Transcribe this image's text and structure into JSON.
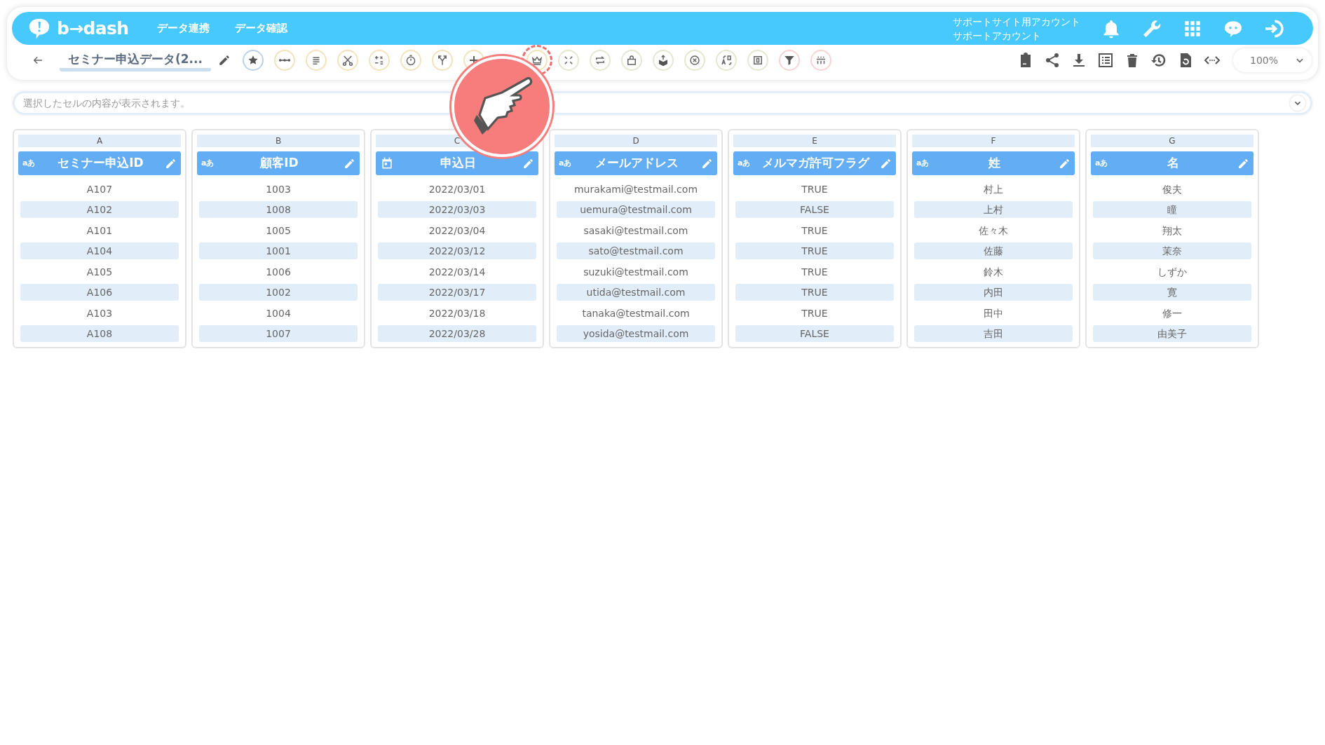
{
  "header": {
    "logo": "b→dash",
    "nav": [
      {
        "label": "データ連携"
      },
      {
        "label": "データ確認"
      }
    ],
    "account": {
      "line_1": "サポートサイト用アカウント",
      "line_2": "サポートアカウント"
    },
    "icons": [
      {
        "kind": "bell"
      },
      {
        "kind": "wrench"
      },
      {
        "kind": "grid"
      },
      {
        "kind": "mascot"
      },
      {
        "kind": "logout"
      }
    ]
  },
  "toolbar": {
    "title": "セミナー申込データ(2...",
    "tools": [
      {
        "kind": "star",
        "color": "#b9d3ea",
        "highlighted": false
      },
      {
        "kind": "dots",
        "color": "#f3e3bd",
        "highlighted": false
      },
      {
        "kind": "lines",
        "color": "#f3e3bd",
        "highlighted": false
      },
      {
        "kind": "scissors",
        "color": "#f3e3bd",
        "highlighted": false
      },
      {
        "kind": "calc",
        "color": "#f3e3bd",
        "highlighted": false
      },
      {
        "kind": "timer",
        "color": "#f3e3bd",
        "highlighted": false
      },
      {
        "kind": "fork",
        "color": "#f3e3bd",
        "highlighted": false
      },
      {
        "kind": "plus",
        "color": "#f3e3bd",
        "highlighted": false
      },
      {
        "kind": "crown",
        "color": "#f3e3bd",
        "highlighted": true
      },
      {
        "kind": "compress",
        "color": "#e3e8cf",
        "highlighted": false
      },
      {
        "kind": "repeat",
        "color": "#e3e8cf",
        "highlighted": false
      },
      {
        "kind": "lockbox",
        "color": "#e3e8cf",
        "highlighted": false
      },
      {
        "kind": "upload",
        "color": "#e3e8cf",
        "highlighted": false
      },
      {
        "kind": "xcircle",
        "color": "#e3e8cf",
        "highlighted": false
      },
      {
        "kind": "translate",
        "color": "#e3e8cf",
        "highlighted": false
      },
      {
        "kind": "zero",
        "color": "#e3e8cf",
        "highlighted": false
      },
      {
        "kind": "funnel",
        "color": "#f8d3d3",
        "highlighted": false
      },
      {
        "kind": "people",
        "color": "#f8d3d3",
        "highlighted": false
      }
    ],
    "actions": [
      {
        "kind": "clipboard"
      },
      {
        "kind": "share"
      },
      {
        "kind": "download"
      },
      {
        "kind": "list"
      },
      {
        "kind": "trash"
      },
      {
        "kind": "history"
      },
      {
        "kind": "filerefresh"
      },
      {
        "kind": "code"
      }
    ],
    "zoom": "100%"
  },
  "cell_viewer": {
    "placeholder": "選択したセルの内容が表示されます。"
  },
  "table": {
    "columns": [
      {
        "letter": "A",
        "name": "セミナー申込ID",
        "kind": "text",
        "type_label": "aあ",
        "cells": [
          "A107",
          "A102",
          "A101",
          "A104",
          "A105",
          "A106",
          "A103",
          "A108"
        ]
      },
      {
        "letter": "B",
        "name": "顧客ID",
        "kind": "text",
        "type_label": "aあ",
        "cells": [
          "1003",
          "1008",
          "1005",
          "1001",
          "1006",
          "1002",
          "1004",
          "1007"
        ]
      },
      {
        "letter": "C",
        "name": "申込日",
        "kind": "date",
        "cells": [
          "2022/03/01",
          "2022/03/03",
          "2022/03/04",
          "2022/03/12",
          "2022/03/14",
          "2022/03/17",
          "2022/03/18",
          "2022/03/28"
        ]
      },
      {
        "letter": "D",
        "name": "メールアドレス",
        "kind": "text",
        "type_label": "aあ",
        "cells": [
          "murakami@testmail.com",
          "uemura@testmail.com",
          "sasaki@testmail.com",
          "sato@testmail.com",
          "suzuki@testmail.com",
          "utida@testmail.com",
          "tanaka@testmail.com",
          "yosida@testmail.com"
        ]
      },
      {
        "letter": "E",
        "name": "メルマガ許可フラグ",
        "kind": "text",
        "type_label": "aあ",
        "cells": [
          "TRUE",
          "FALSE",
          "TRUE",
          "TRUE",
          "TRUE",
          "TRUE",
          "TRUE",
          "FALSE"
        ]
      },
      {
        "letter": "F",
        "name": "姓",
        "kind": "text",
        "type_label": "aあ",
        "cells": [
          "村上",
          "上村",
          "佐々木",
          "佐藤",
          "鈴木",
          "内田",
          "田中",
          "吉田"
        ]
      },
      {
        "letter": "G",
        "name": "名",
        "kind": "text",
        "type_label": "aあ",
        "cells": [
          "俊夫",
          "瞳",
          "翔太",
          "茉奈",
          "しずか",
          "寛",
          "修一",
          "由美子"
        ]
      }
    ]
  },
  "tutorial_pointer": {
    "visible": true
  }
}
